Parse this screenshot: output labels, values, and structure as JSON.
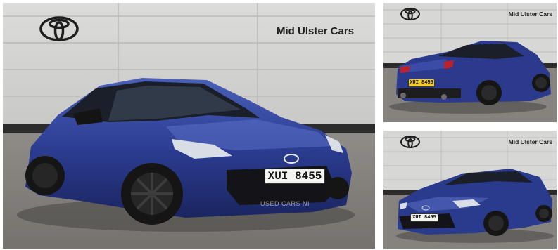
{
  "gallery": {
    "main_photo": {
      "dealer_name": "Mid Ulster Cars",
      "registration": "XUI 8455",
      "watermark": "USED CARS NI",
      "brand_logo": "toyota-logo",
      "view": "front three-quarter"
    },
    "thumbnails": [
      {
        "dealer_name": "Mid Ulster Cars",
        "registration": "XUI 8455",
        "brand_logo": "toyota-logo",
        "view": "rear three-quarter"
      },
      {
        "dealer_name": "Mid Ulster Cars",
        "registration": "XUI 8455",
        "brand_logo": "toyota-logo",
        "view": "front three-quarter"
      }
    ]
  },
  "colors": {
    "car_body": "#2a3a8c",
    "wall": "#d4d4d2",
    "floor": "#8a8783",
    "plate_front": "#f4f4f0",
    "plate_rear": "#f2cc2b"
  }
}
